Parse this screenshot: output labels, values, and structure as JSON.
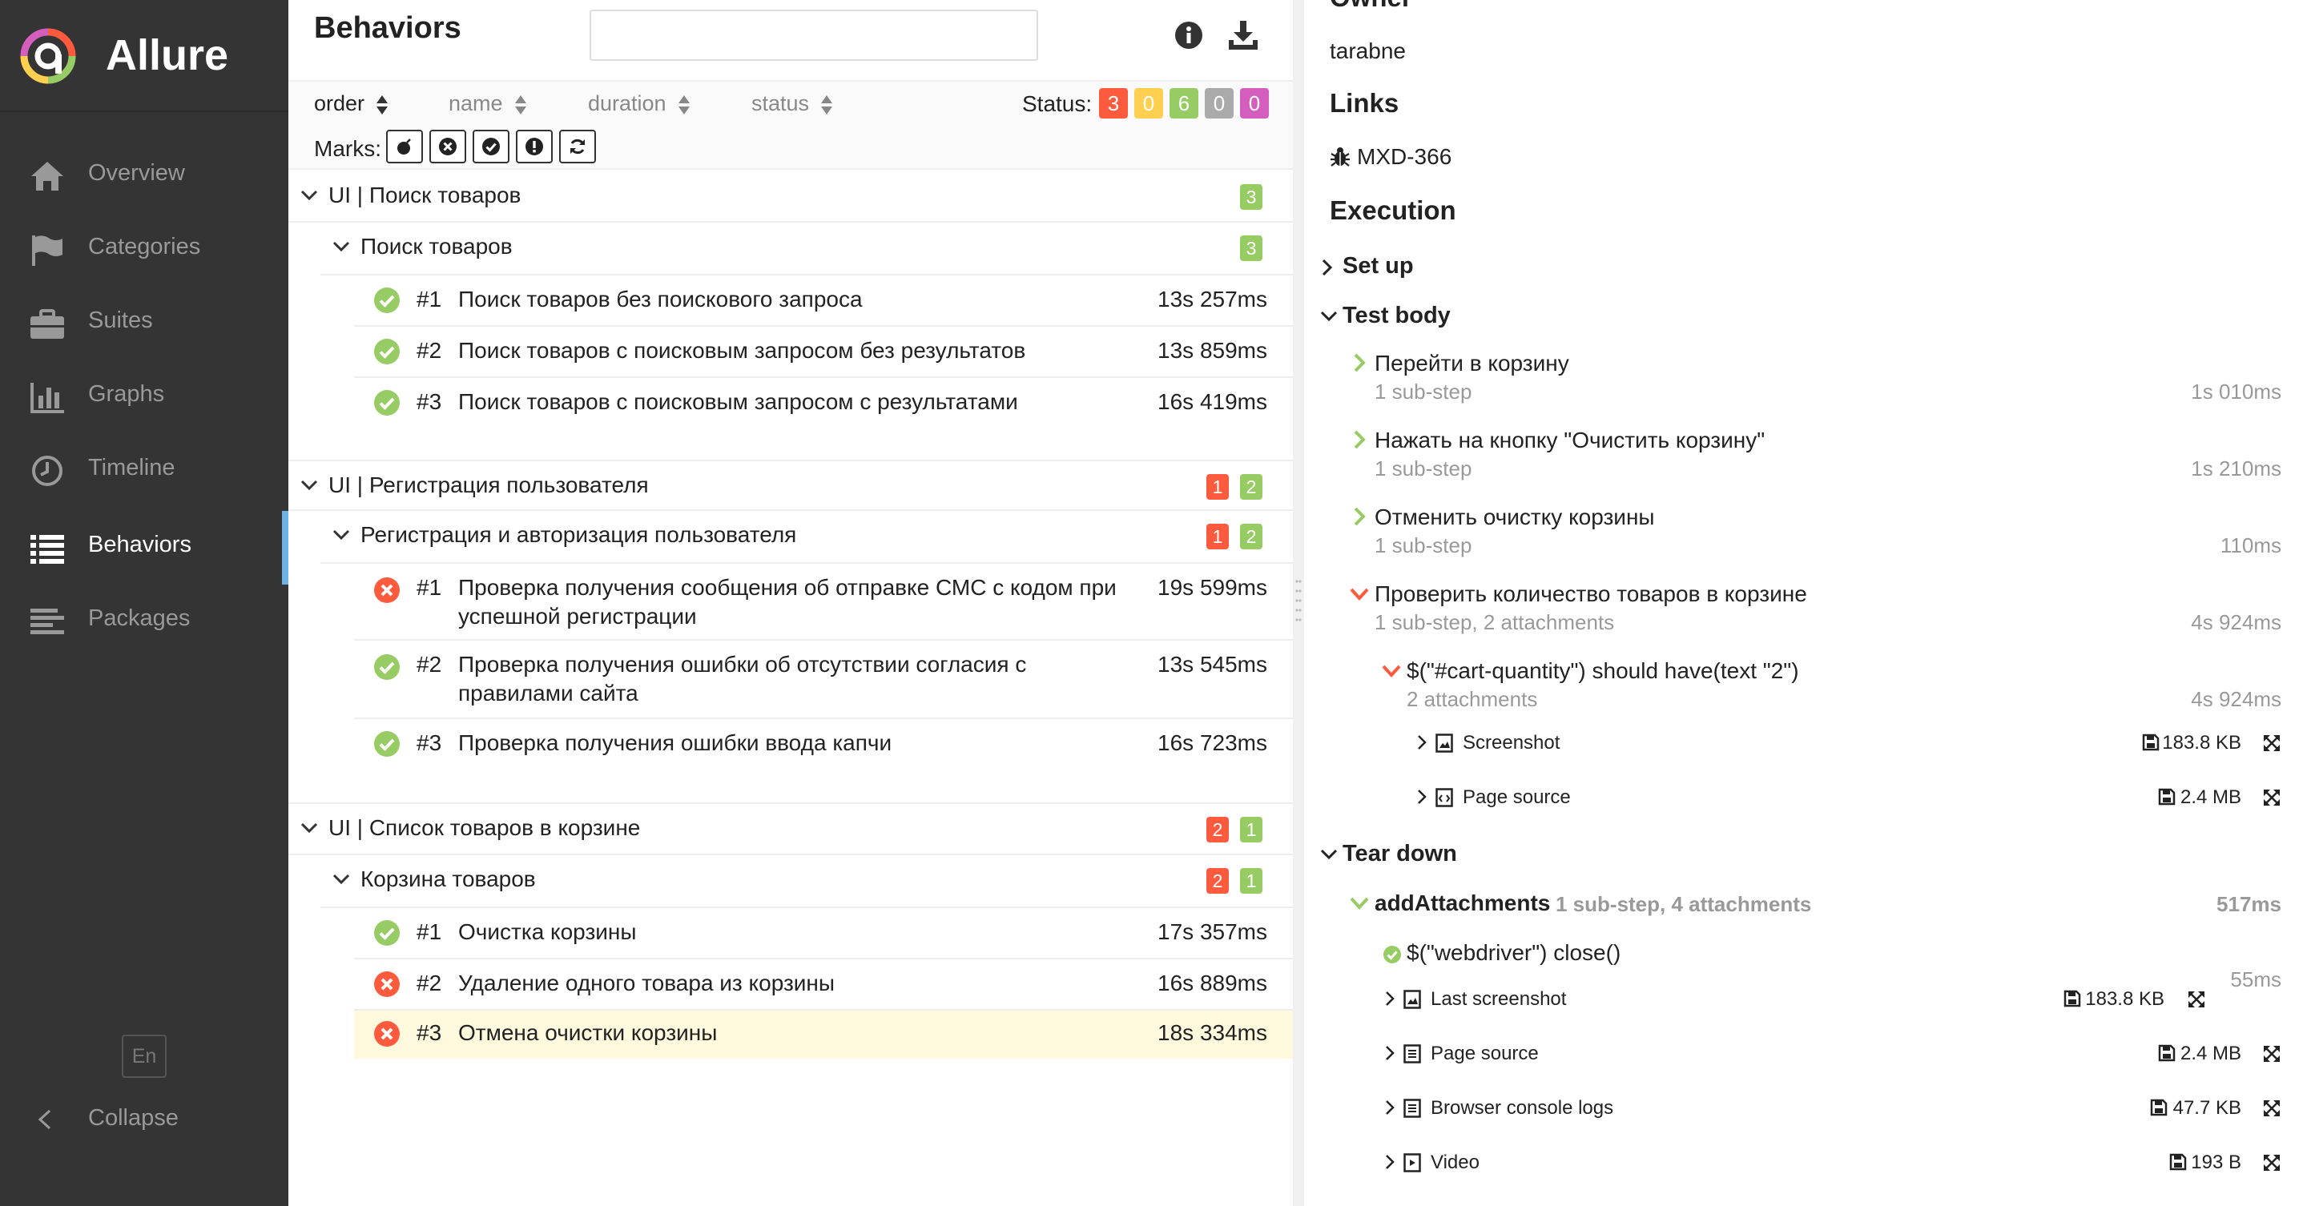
{
  "app": {
    "name": "Allure"
  },
  "colors": {
    "failed": "#fd5a3e",
    "broken": "#ffd050",
    "passed": "#97cc64",
    "skipped": "#aaaaaa",
    "unknown": "#d35ebe",
    "accent": "#6fb2e4",
    "sidebar_bg": "#343434"
  },
  "sidebar": {
    "items": [
      {
        "label": "Overview",
        "icon": "home-icon"
      },
      {
        "label": "Categories",
        "icon": "flag-icon"
      },
      {
        "label": "Suites",
        "icon": "briefcase-icon"
      },
      {
        "label": "Graphs",
        "icon": "bar-chart-icon"
      },
      {
        "label": "Timeline",
        "icon": "clock-icon"
      },
      {
        "label": "Behaviors",
        "icon": "list-icon",
        "active": true
      },
      {
        "label": "Packages",
        "icon": "align-left-icon"
      }
    ],
    "language": "En",
    "collapse_label": "Collapse"
  },
  "behaviors": {
    "title": "Behaviors",
    "search_placeholder": "",
    "sort": [
      "order",
      "name",
      "duration",
      "status"
    ],
    "status_label": "Status:",
    "status_counts": [
      "3",
      "0",
      "6",
      "0",
      "0"
    ],
    "marks_label": "Marks:",
    "groups": [
      {
        "name": "UI | Поиск товаров",
        "counts": {
          "failed": "",
          "passed": "3"
        },
        "subgroups": [
          {
            "name": "Поиск товаров",
            "counts": {
              "failed": "",
              "passed": "3"
            },
            "cases": [
              {
                "num": "#1",
                "name": "Поиск товаров без поискового запроса",
                "duration": "13s 257ms",
                "status": "passed"
              },
              {
                "num": "#2",
                "name": "Поиск товаров с поисковым запросом без результатов",
                "duration": "13s 859ms",
                "status": "passed"
              },
              {
                "num": "#3",
                "name": "Поиск товаров с поисковым запросом с результатами",
                "duration": "16s 419ms",
                "status": "passed"
              }
            ]
          }
        ]
      },
      {
        "name": "UI | Регистрация пользователя",
        "counts": {
          "failed": "1",
          "passed": "2"
        },
        "subgroups": [
          {
            "name": "Регистрация и авторизация пользователя",
            "counts": {
              "failed": "1",
              "passed": "2"
            },
            "cases": [
              {
                "num": "#1",
                "name": "Проверка получения сообщения об отправке СМС с кодом при успешной регистрации",
                "duration": "19s 599ms",
                "status": "failed"
              },
              {
                "num": "#2",
                "name": "Проверка получения ошибки об отсутствии согласия с правилами сайта",
                "duration": "13s 545ms",
                "status": "passed"
              },
              {
                "num": "#3",
                "name": "Проверка получения ошибки ввода капчи",
                "duration": "16s 723ms",
                "status": "passed"
              }
            ]
          }
        ]
      },
      {
        "name": "UI | Список товаров в корзине",
        "counts": {
          "failed": "2",
          "passed": "1"
        },
        "subgroups": [
          {
            "name": "Корзина товаров",
            "counts": {
              "failed": "2",
              "passed": "1"
            },
            "cases": [
              {
                "num": "#1",
                "name": "Очистка корзины",
                "duration": "17s 357ms",
                "status": "passed"
              },
              {
                "num": "#2",
                "name": "Удаление одного товара из корзины",
                "duration": "16s 889ms",
                "status": "failed"
              },
              {
                "num": "#3",
                "name": "Отмена очистки корзины",
                "duration": "18s 334ms",
                "status": "failed",
                "selected": true
              }
            ]
          }
        ]
      }
    ]
  },
  "detail": {
    "owner_heading": "Owner",
    "owner": "tarabne",
    "links_heading": "Links",
    "link": "MXD-366",
    "execution_heading": "Execution",
    "setup": "Set up",
    "test_body": "Test body",
    "steps": [
      {
        "name": "Перейти в корзину",
        "sub": "1 sub-step",
        "duration": "1s 010ms"
      },
      {
        "name": "Нажать на кнопку \"Очистить корзину\"",
        "sub": "1 sub-step",
        "duration": "1s 210ms"
      },
      {
        "name": "Отменить очистку корзины",
        "sub": "1 sub-step",
        "duration": "110ms"
      },
      {
        "name": "Проверить количество товаров в корзине",
        "sub": "1 sub-step, 2 attachments",
        "duration": "4s 924ms"
      }
    ],
    "nested_step": {
      "name": "$(\"#cart-quantity\") should have(text \"2\")",
      "sub": "2 attachments",
      "duration": "4s 924ms"
    },
    "nested_attachments": [
      {
        "name": "Screenshot",
        "size": "183.8 KB"
      },
      {
        "name": "Page source",
        "size": "2.4 MB"
      }
    ],
    "teardown": "Tear down",
    "teardown_step": {
      "name": "addAttachments",
      "sub": "1 sub-step, 4 attachments",
      "duration": "517ms"
    },
    "teardown_substep": {
      "name": "$(\"webdriver\") close()",
      "duration": "55ms"
    },
    "teardown_attachments": [
      {
        "name": "Last screenshot",
        "size": "183.8 KB"
      },
      {
        "name": "Page source",
        "size": "2.4 MB"
      },
      {
        "name": "Browser console logs",
        "size": "47.7 KB"
      },
      {
        "name": "Video",
        "size": "193 B"
      }
    ]
  }
}
